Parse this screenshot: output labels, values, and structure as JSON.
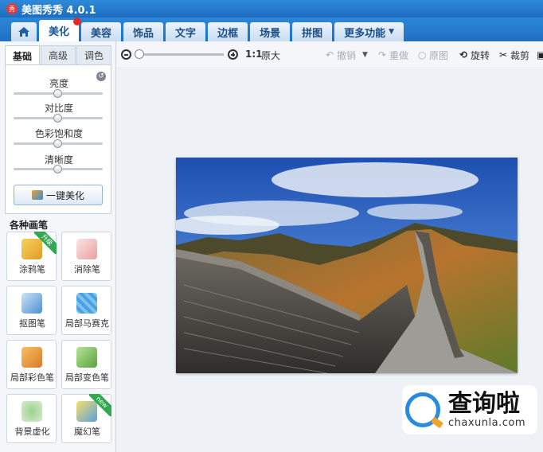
{
  "app": {
    "title": "美图秀秀 4.0.1",
    "logo_text": "秀"
  },
  "tabs": [
    {
      "label": "美化",
      "active": true,
      "notification": true
    },
    {
      "label": "美容"
    },
    {
      "label": "饰品"
    },
    {
      "label": "文字"
    },
    {
      "label": "边框"
    },
    {
      "label": "场景"
    },
    {
      "label": "拼图"
    },
    {
      "label": "更多功能",
      "has_dropdown": true
    }
  ],
  "left_panel": {
    "subtabs": [
      {
        "label": "基础",
        "active": true
      },
      {
        "label": "高级"
      },
      {
        "label": "调色"
      }
    ],
    "sliders": [
      {
        "label": "亮度",
        "value": 0.5
      },
      {
        "label": "对比度",
        "value": 0.5
      },
      {
        "label": "色彩饱和度",
        "value": 0.5
      },
      {
        "label": "清晰度",
        "value": 0.5
      }
    ],
    "onekey_button": "一键美化",
    "brushes_title": "各种画笔",
    "brushes": [
      {
        "label": "涂鸦笔",
        "icon": "pencil-icon",
        "badge": "升级"
      },
      {
        "label": "消除笔",
        "icon": "eraser-icon"
      },
      {
        "label": "抠图笔",
        "icon": "pen-nib-icon"
      },
      {
        "label": "局部马赛克",
        "icon": "mosaic-icon"
      },
      {
        "label": "局部彩色笔",
        "icon": "paint-brush-icon"
      },
      {
        "label": "局部变色笔",
        "icon": "color-bucket-icon"
      },
      {
        "label": "背景虚化",
        "icon": "blur-icon"
      },
      {
        "label": "魔幻笔",
        "icon": "magic-wand-icon",
        "badge": "new"
      }
    ]
  },
  "toolbar": {
    "zoom_actual": "1:1",
    "zoom_original_label": "原大",
    "undo_label": "撤销",
    "redo_label": "重做",
    "original_label": "原图",
    "rotate_label": "旋转",
    "crop_label": "裁剪"
  },
  "watermark": {
    "cn": "查询啦",
    "en": "chaxunla.com"
  }
}
